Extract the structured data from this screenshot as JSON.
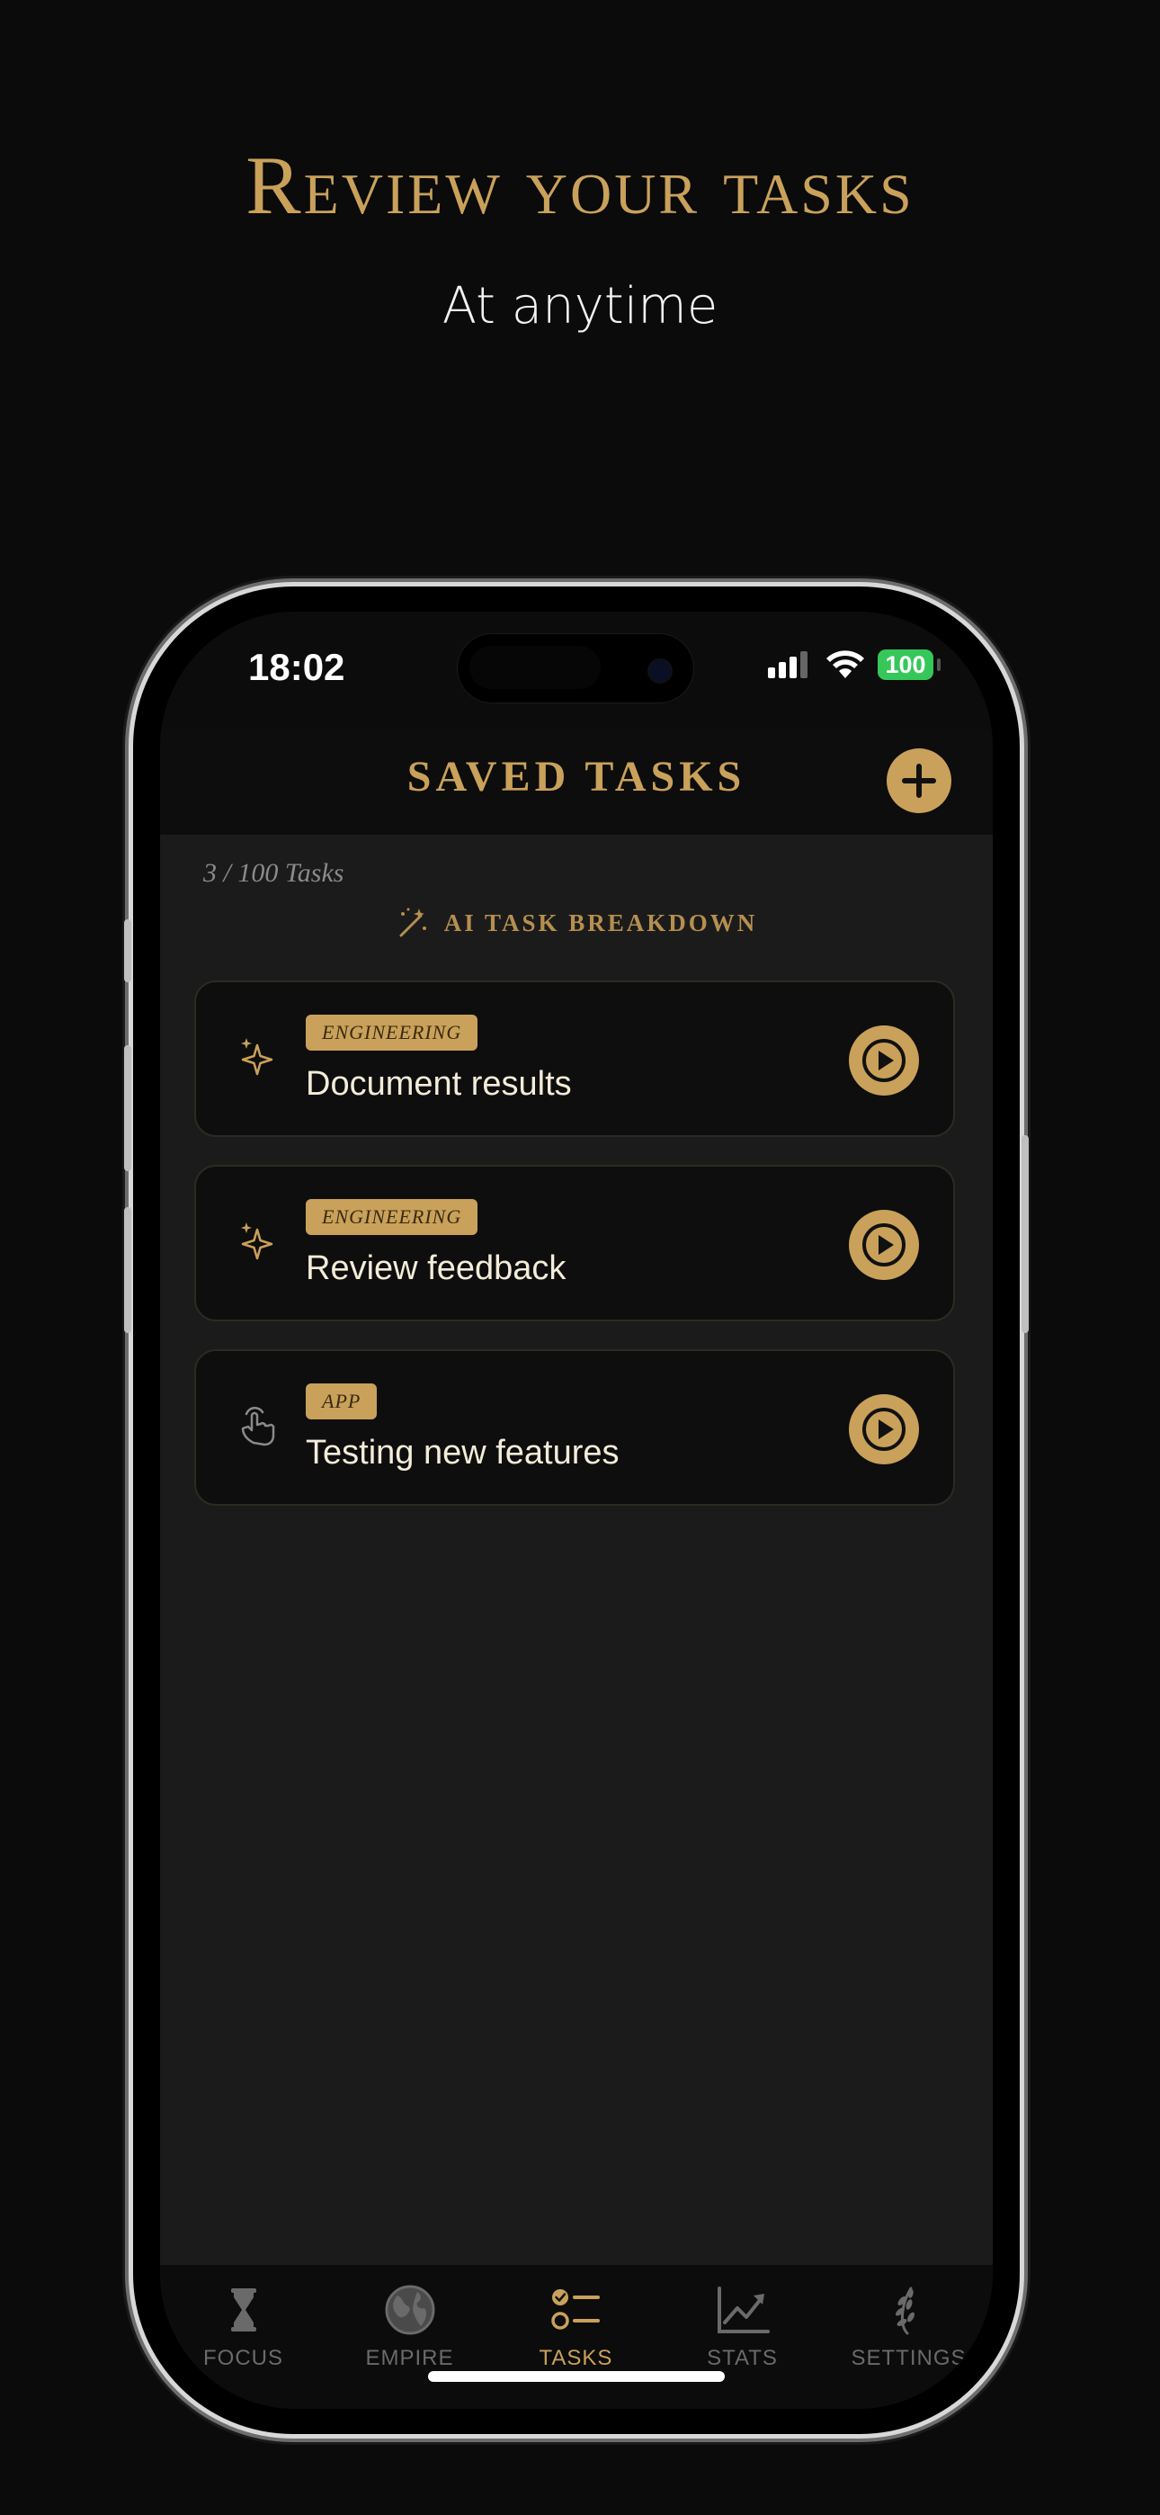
{
  "promo": {
    "headline": "Review your tasks",
    "subheadline": "At anytime"
  },
  "status_bar": {
    "time": "18:02",
    "battery": "100"
  },
  "header": {
    "title": "SAVED TASKS",
    "add_icon": "plus-icon"
  },
  "tasks_count": "3 / 100 Tasks",
  "ai_breakdown_label": "AI TASK BREAKDOWN",
  "tasks": [
    {
      "tag": "ENGINEERING",
      "title": "Document results",
      "icon": "sparkles-icon"
    },
    {
      "tag": "ENGINEERING",
      "title": "Review feedback",
      "icon": "sparkles-icon"
    },
    {
      "tag": "APP",
      "title": "Testing new features",
      "icon": "hand-pointer-icon"
    }
  ],
  "tabbar": {
    "items": [
      {
        "label": "FOCUS",
        "icon": "hourglass-icon",
        "active": false
      },
      {
        "label": "EMPIRE",
        "icon": "globe-icon",
        "active": false
      },
      {
        "label": "TASKS",
        "icon": "checklist-icon",
        "active": true
      },
      {
        "label": "STATS",
        "icon": "chart-line-icon",
        "active": false
      },
      {
        "label": "SETTINGS",
        "icon": "laurel-icon",
        "active": false
      }
    ]
  },
  "colors": {
    "accent": "#c9a15a",
    "background": "#0b0b0c",
    "content_bg": "#1b1b1b",
    "battery": "#35c759"
  }
}
